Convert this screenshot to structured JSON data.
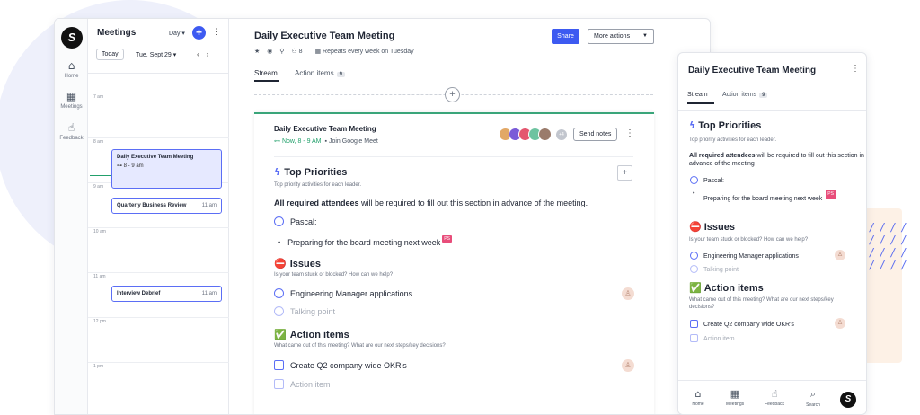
{
  "app": {
    "logo": "S",
    "rail": [
      {
        "label": "Home",
        "icon": "home-icon"
      },
      {
        "label": "Meetings",
        "icon": "calendar-icon"
      },
      {
        "label": "Feedback",
        "icon": "thumbs-up-icon"
      }
    ]
  },
  "calendar": {
    "title": "Meetings",
    "view": "Day ▾",
    "today": "Today",
    "date": "Tue, Sept 29 ▾",
    "hours": [
      "7 am",
      "8 am",
      "9 am",
      "10 am",
      "11 am",
      "12 pm",
      "1 pm"
    ],
    "events": [
      {
        "title": "Daily Executive Team Meeting",
        "sub": "⊶ 8 - 9 am",
        "time": ""
      },
      {
        "title": "Quarterly Business Review",
        "sub": "",
        "time": "11 am"
      },
      {
        "title": "Interview Debrief",
        "sub": "",
        "time": "11 am"
      }
    ]
  },
  "meeting": {
    "title": "Daily Executive Team Meeting",
    "meta": {
      "attendees": "8",
      "repeat": "Repeats every week on Tuesday"
    },
    "share": "Share",
    "more_actions": "More actions",
    "tabs": {
      "stream": "Stream",
      "action_items": "Action items",
      "action_count": "9"
    }
  },
  "card": {
    "title": "Daily Executive Team Meeting",
    "when": "⊶ Now, 8 - 9 AM",
    "join": "Join Google Meet",
    "avatars_more": "+4",
    "send_notes": "Send notes",
    "priorities": {
      "heading": "Top Priorities",
      "desc": "Top priority activities for each leader.",
      "req_bold": "All required attendees",
      "req_rest": " will be required to fill out this section in advance of the meeting.",
      "person": "Pascal:",
      "bullet": "Preparing for the board meeting next week",
      "tag": "PS"
    },
    "issues": {
      "heading": "Issues",
      "desc": "Is your team stuck or blocked? How can we help?",
      "item": "Engineering Manager applications",
      "placeholder": "Talking point"
    },
    "actions": {
      "heading": "Action items",
      "desc": "What came out of this meeting? What are our next steps/key decisions?",
      "item": "Create Q2 company wide OKR's",
      "placeholder": "Action item"
    }
  },
  "mobile": {
    "title": "Daily Executive Team Meeting",
    "tabs": {
      "stream": "Stream",
      "action_items": "Action items",
      "action_count": "9"
    },
    "priorities": {
      "heading": "Top Priorities",
      "desc": "Top priority activities for each leader.",
      "req_bold": "All required attendees",
      "req_rest": " will be required to fill out this section in advance of the meeting",
      "person": "Pascal:",
      "bullet": "Preparing for the board meeting next week",
      "tag": "PS"
    },
    "issues": {
      "heading": "Issues",
      "desc": "Is your team stuck or blocked? How can we help?",
      "item": "Engineering Manager applications",
      "placeholder": "Talking point"
    },
    "actions": {
      "heading": "Action items",
      "desc": "What came out of this meeting? What are our next steps/key decisions?",
      "item": "Create Q2 company wide OKR's",
      "placeholder": "Action item"
    },
    "nav": [
      "Home",
      "Meetings",
      "Feedback",
      "Search"
    ]
  },
  "colors": {
    "accent": "#3d5af1",
    "now": "#22a06b",
    "tag": "#e84d7a"
  }
}
